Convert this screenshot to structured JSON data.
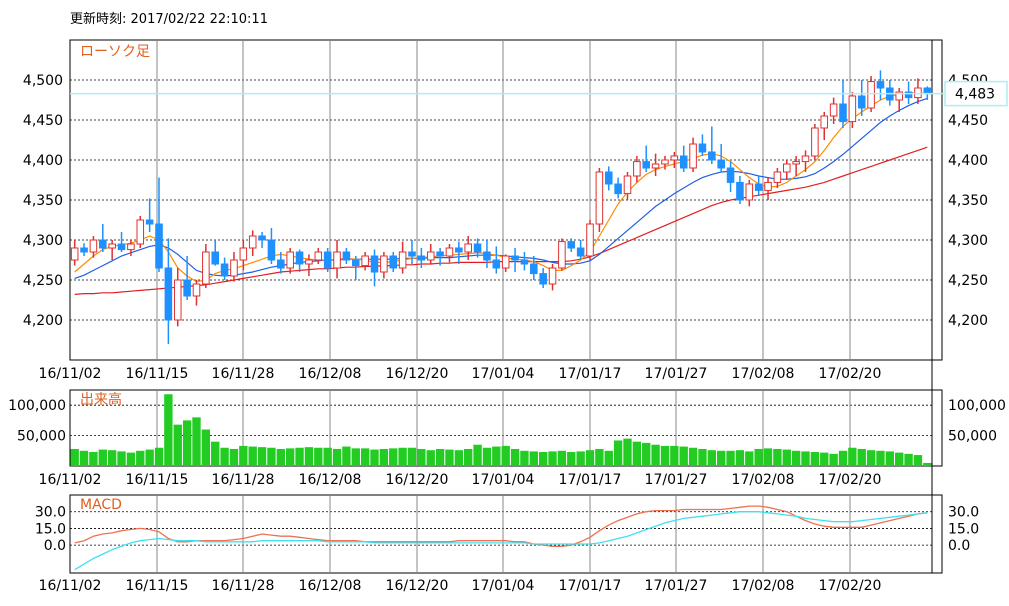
{
  "header": {
    "label": "更新時刻:",
    "timestamp": "2017/02/22 22:10:11"
  },
  "colors": {
    "up": "#e03030",
    "down": "#1e90ff",
    "ma_short": "#ff8c00",
    "ma_mid": "#1e5fe8",
    "ma_long": "#e02020",
    "volume": "#22cc22",
    "macd": "#f07050",
    "signal": "#40e0f0",
    "title": "#e06020",
    "current_line": "#aeeef2"
  },
  "chart_data": [
    {
      "type": "candlestick",
      "title": "ローソク足",
      "ylim": [
        4150,
        4550
      ],
      "yticks": [
        "4,200",
        "4,250",
        "4,300",
        "4,350",
        "4,400",
        "4,450",
        "4,500"
      ],
      "ytick_values": [
        4200,
        4250,
        4300,
        4350,
        4400,
        4450,
        4500
      ],
      "current_value": 4483,
      "current_label": "4,483",
      "x_tick_labels": [
        "16/11/02",
        "16/11/15",
        "16/11/28",
        "16/12/08",
        "16/12/20",
        "17/01/04",
        "17/01/17",
        "17/01/27",
        "17/02/08",
        "17/02/20"
      ],
      "candles": [
        [
          4275,
          4300,
          4268,
          4290
        ],
        [
          4290,
          4296,
          4280,
          4285
        ],
        [
          4285,
          4305,
          4278,
          4300
        ],
        [
          4300,
          4320,
          4285,
          4290
        ],
        [
          4290,
          4300,
          4275,
          4295
        ],
        [
          4295,
          4310,
          4285,
          4288
        ],
        [
          4288,
          4300,
          4280,
          4295
        ],
        [
          4295,
          4330,
          4290,
          4325
        ],
        [
          4325,
          4352,
          4310,
          4320
        ],
        [
          4320,
          4378,
          4260,
          4265
        ],
        [
          4265,
          4302,
          4170,
          4200
        ],
        [
          4200,
          4265,
          4192,
          4250
        ],
        [
          4250,
          4280,
          4225,
          4230
        ],
        [
          4230,
          4250,
          4218,
          4245
        ],
        [
          4245,
          4295,
          4240,
          4285
        ],
        [
          4285,
          4300,
          4268,
          4270
        ],
        [
          4270,
          4278,
          4250,
          4255
        ],
        [
          4255,
          4285,
          4248,
          4275
        ],
        [
          4275,
          4300,
          4262,
          4290
        ],
        [
          4290,
          4312,
          4280,
          4305
        ],
        [
          4305,
          4310,
          4290,
          4300
        ],
        [
          4300,
          4315,
          4270,
          4275
        ],
        [
          4275,
          4285,
          4258,
          4265
        ],
        [
          4265,
          4290,
          4258,
          4285
        ],
        [
          4285,
          4288,
          4260,
          4270
        ],
        [
          4270,
          4282,
          4255,
          4275
        ],
        [
          4275,
          4290,
          4270,
          4285
        ],
        [
          4285,
          4290,
          4260,
          4265
        ],
        [
          4265,
          4300,
          4252,
          4285
        ],
        [
          4285,
          4290,
          4270,
          4275
        ],
        [
          4275,
          4280,
          4250,
          4268
        ],
        [
          4268,
          4285,
          4262,
          4280
        ],
        [
          4280,
          4288,
          4242,
          4260
        ],
        [
          4260,
          4285,
          4252,
          4280
        ],
        [
          4280,
          4285,
          4260,
          4265
        ],
        [
          4265,
          4298,
          4258,
          4285
        ],
        [
          4285,
          4300,
          4270,
          4280
        ],
        [
          4280,
          4290,
          4265,
          4275
        ],
        [
          4275,
          4295,
          4270,
          4285
        ],
        [
          4285,
          4290,
          4268,
          4280
        ],
        [
          4280,
          4295,
          4272,
          4290
        ],
        [
          4290,
          4298,
          4270,
          4285
        ],
        [
          4285,
          4305,
          4275,
          4295
        ],
        [
          4295,
          4302,
          4278,
          4285
        ],
        [
          4285,
          4300,
          4265,
          4275
        ],
        [
          4275,
          4292,
          4258,
          4265
        ],
        [
          4265,
          4282,
          4260,
          4280
        ],
        [
          4280,
          4290,
          4260,
          4275
        ],
        [
          4275,
          4285,
          4262,
          4270
        ],
        [
          4270,
          4280,
          4250,
          4258
        ],
        [
          4258,
          4265,
          4240,
          4245
        ],
        [
          4245,
          4270,
          4237,
          4265
        ],
        [
          4265,
          4302,
          4262,
          4298
        ],
        [
          4298,
          4302,
          4285,
          4290
        ],
        [
          4290,
          4300,
          4275,
          4280
        ],
        [
          4280,
          4325,
          4275,
          4320
        ],
        [
          4320,
          4390,
          4310,
          4385
        ],
        [
          4385,
          4392,
          4362,
          4370
        ],
        [
          4370,
          4378,
          4352,
          4358
        ],
        [
          4358,
          4385,
          4350,
          4380
        ],
        [
          4380,
          4405,
          4372,
          4398
        ],
        [
          4398,
          4418,
          4385,
          4390
        ],
        [
          4390,
          4408,
          4380,
          4395
        ],
        [
          4395,
          4405,
          4388,
          4400
        ],
        [
          4400,
          4410,
          4390,
          4405
        ],
        [
          4405,
          4418,
          4385,
          4390
        ],
        [
          4390,
          4428,
          4385,
          4420
        ],
        [
          4420,
          4432,
          4405,
          4410
        ],
        [
          4410,
          4442,
          4395,
          4400
        ],
        [
          4400,
          4420,
          4385,
          4390
        ],
        [
          4390,
          4398,
          4360,
          4372
        ],
        [
          4372,
          4380,
          4345,
          4350
        ],
        [
          4350,
          4375,
          4342,
          4370
        ],
        [
          4370,
          4380,
          4355,
          4362
        ],
        [
          4362,
          4378,
          4350,
          4372
        ],
        [
          4372,
          4390,
          4365,
          4385
        ],
        [
          4385,
          4400,
          4375,
          4395
        ],
        [
          4395,
          4405,
          4380,
          4398
        ],
        [
          4398,
          4412,
          4385,
          4405
        ],
        [
          4405,
          4445,
          4400,
          4440
        ],
        [
          4440,
          4460,
          4425,
          4455
        ],
        [
          4455,
          4478,
          4445,
          4470
        ],
        [
          4470,
          4500,
          4440,
          4448
        ],
        [
          4448,
          4485,
          4440,
          4480
        ],
        [
          4480,
          4500,
          4455,
          4465
        ],
        [
          4465,
          4505,
          4460,
          4498
        ],
        [
          4498,
          4512,
          4475,
          4490
        ],
        [
          4490,
          4500,
          4468,
          4475
        ],
        [
          4475,
          4490,
          4460,
          4485
        ],
        [
          4485,
          4498,
          4470,
          4478
        ],
        [
          4478,
          4502,
          4470,
          4490
        ],
        [
          4490,
          4492,
          4475,
          4483
        ]
      ],
      "ma_short": [
        4260,
        4270,
        4280,
        4288,
        4292,
        4294,
        4296,
        4300,
        4305,
        4300,
        4285,
        4265,
        4255,
        4248,
        4250,
        4258,
        4262,
        4264,
        4268,
        4272,
        4276,
        4280,
        4282,
        4280,
        4278,
        4276,
        4275,
        4275,
        4276,
        4277,
        4276,
        4275,
        4272,
        4272,
        4273,
        4275,
        4277,
        4278,
        4279,
        4280,
        4281,
        4282,
        4283,
        4284,
        4283,
        4281,
        4278,
        4276,
        4275,
        4273,
        4268,
        4262,
        4262,
        4268,
        4275,
        4285,
        4305,
        4325,
        4345,
        4360,
        4372,
        4382,
        4388,
        4392,
        4395,
        4398,
        4402,
        4406,
        4408,
        4405,
        4398,
        4388,
        4378,
        4370,
        4366,
        4367,
        4372,
        4380,
        4388,
        4398,
        4412,
        4428,
        4442,
        4452,
        4460,
        4468,
        4475,
        4480,
        4482,
        4484,
        4484,
        4483
      ],
      "ma_mid": [
        4252,
        4256,
        4262,
        4268,
        4274,
        4280,
        4284,
        4288,
        4292,
        4294,
        4290,
        4282,
        4272,
        4262,
        4258,
        4256,
        4255,
        4256,
        4258,
        4260,
        4263,
        4266,
        4268,
        4270,
        4272,
        4273,
        4274,
        4275,
        4275,
        4276,
        4276,
        4276,
        4276,
        4276,
        4276,
        4277,
        4277,
        4277,
        4278,
        4278,
        4278,
        4279,
        4280,
        4281,
        4281,
        4281,
        4280,
        4279,
        4278,
        4277,
        4275,
        4272,
        4270,
        4270,
        4271,
        4274,
        4282,
        4292,
        4302,
        4312,
        4322,
        4332,
        4342,
        4350,
        4358,
        4365,
        4372,
        4378,
        4382,
        4385,
        4386,
        4385,
        4383,
        4380,
        4378,
        4376,
        4376,
        4377,
        4379,
        4383,
        4390,
        4398,
        4407,
        4417,
        4427,
        4437,
        4447,
        4455,
        4462,
        4468,
        4473,
        4477
      ],
      "ma_long": [
        4232,
        4233,
        4233,
        4234,
        4234,
        4235,
        4236,
        4237,
        4238,
        4239,
        4240,
        4241,
        4242,
        4243,
        4244,
        4246,
        4248,
        4250,
        4252,
        4254,
        4256,
        4258,
        4260,
        4261,
        4262,
        4263,
        4264,
        4264,
        4265,
        4266,
        4266,
        4267,
        4267,
        4268,
        4268,
        4269,
        4269,
        4270,
        4270,
        4271,
        4271,
        4272,
        4272,
        4272,
        4272,
        4273,
        4273,
        4273,
        4273,
        4273,
        4273,
        4273,
        4273,
        4274,
        4276,
        4279,
        4283,
        4288,
        4293,
        4298,
        4303,
        4308,
        4313,
        4318,
        4323,
        4328,
        4333,
        4338,
        4343,
        4347,
        4350,
        4352,
        4354,
        4356,
        4358,
        4360,
        4362,
        4364,
        4366,
        4369,
        4372,
        4376,
        4380,
        4384,
        4388,
        4392,
        4396,
        4400,
        4404,
        4408,
        4412,
        4416
      ]
    },
    {
      "type": "bar",
      "title": "出来高",
      "ylim": [
        0,
        125000
      ],
      "yticks": [
        "50,000",
        "100,000"
      ],
      "ytick_values": [
        50000,
        100000
      ],
      "values": [
        28000,
        25000,
        23000,
        27000,
        26000,
        24000,
        22000,
        25000,
        27000,
        30000,
        118000,
        68000,
        75000,
        80000,
        60000,
        40000,
        30000,
        28000,
        33000,
        32000,
        31000,
        30000,
        28000,
        29000,
        30000,
        31000,
        30000,
        30000,
        28000,
        32000,
        29000,
        29000,
        27000,
        28000,
        29000,
        30000,
        30000,
        28000,
        26000,
        28000,
        27000,
        26000,
        28000,
        35000,
        30000,
        32000,
        33000,
        28000,
        25000,
        24000,
        23000,
        24000,
        25000,
        23000,
        24000,
        26000,
        28000,
        25000,
        42000,
        45000,
        40000,
        38000,
        35000,
        33000,
        33000,
        32000,
        30000,
        28000,
        26000,
        25000,
        25000,
        26000,
        24000,
        28000,
        29000,
        28000,
        27000,
        25000,
        24000,
        23000,
        22000,
        20000,
        25000,
        30000,
        28000,
        26000,
        25000,
        24000,
        22000,
        20000,
        18000,
        5000
      ]
    },
    {
      "type": "line",
      "title": "MACD",
      "ylim": [
        -25,
        45
      ],
      "yticks": [
        "0.0",
        "15.0",
        "30.0"
      ],
      "ytick_values": [
        0,
        15,
        30
      ],
      "series": [
        {
          "values": [
            2,
            4,
            8,
            10,
            11,
            13,
            14,
            15,
            14,
            12,
            6,
            3,
            3,
            4,
            4,
            4,
            4,
            5,
            6,
            8,
            10,
            9,
            8,
            8,
            7,
            6,
            5,
            4,
            4,
            4,
            4,
            3,
            3,
            3,
            3,
            3,
            3,
            3,
            3,
            3,
            3,
            4,
            4,
            4,
            4,
            4,
            4,
            3,
            3,
            1,
            0,
            -1,
            -1,
            0,
            3,
            7,
            13,
            18,
            22,
            25,
            28,
            30,
            31,
            31,
            31,
            32,
            32,
            32,
            32,
            32,
            33,
            34,
            35,
            35,
            34,
            32,
            30,
            26,
            22,
            19,
            17,
            16,
            16,
            16,
            16,
            18,
            20,
            22,
            24,
            26,
            28,
            29
          ]
        },
        {
          "values": [
            -22,
            -17,
            -12,
            -8,
            -4,
            -1,
            2,
            4,
            5,
            6,
            5,
            4,
            4,
            4,
            3,
            3,
            3,
            3,
            3,
            3,
            4,
            4,
            4,
            4,
            4,
            4,
            4,
            3,
            3,
            3,
            3,
            3,
            2,
            2,
            2,
            2,
            2,
            2,
            2,
            2,
            2,
            2,
            2,
            2,
            2,
            2,
            2,
            2,
            2,
            1,
            1,
            1,
            1,
            1,
            1,
            1,
            2,
            4,
            6,
            8,
            11,
            14,
            17,
            20,
            22,
            24,
            25,
            26,
            27,
            28,
            29,
            30,
            30,
            30,
            29,
            28,
            27,
            26,
            24,
            23,
            22,
            21,
            21,
            21,
            22,
            23,
            24,
            25,
            26,
            27,
            28,
            29
          ]
        }
      ]
    }
  ]
}
